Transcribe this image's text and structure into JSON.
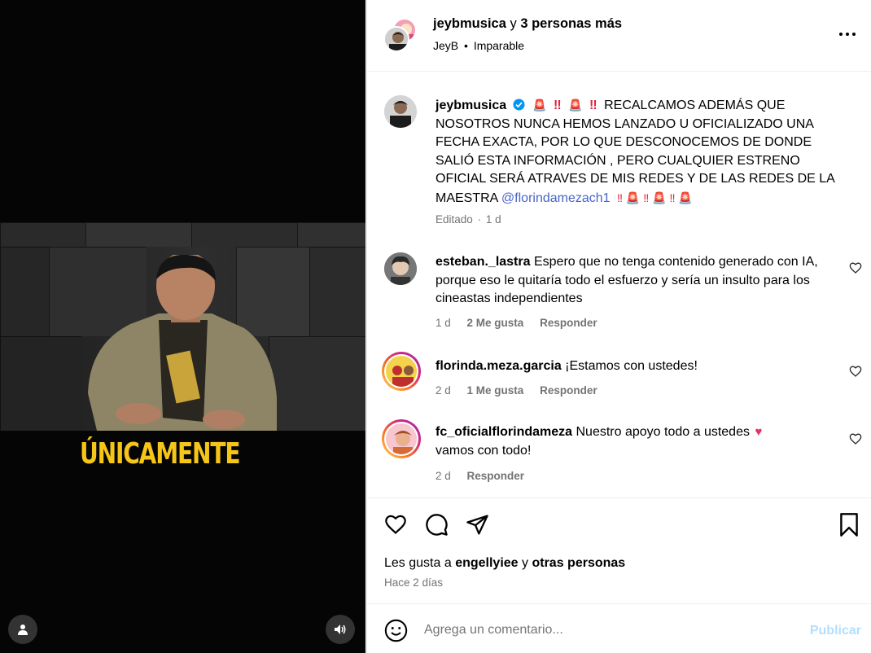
{
  "video": {
    "caption": "ÚNICAMENTE"
  },
  "header": {
    "username": "jeybmusica",
    "connector": "y",
    "others": "3 personas más",
    "audio_artist": "JeyB",
    "audio_separator": "•",
    "audio_title": "Imparable"
  },
  "caption_post": {
    "username": "jeybmusica",
    "text": "RECALCAMOS ADEMÁS QUE NOSOTROS NUNCA HEMOS LANZADO U OFICIALIZADO UNA FECHA EXACTA, POR LO QUE DESCONOCEMOS DE DONDE SALIÓ ESTA INFORMACIÓN , PERO CUALQUIER ESTRENO OFICIAL SERÁ ATRAVES DE MIS REDES Y DE LAS REDES DE LA MAESTRA",
    "mention": "@florindamezach1",
    "edited": "Editado",
    "dot": "·",
    "time": "1 d"
  },
  "comments": [
    {
      "username": "esteban._lastra",
      "text": "Espero que no tenga contenido generado con IA, porque eso le quitaría todo el esfuerzo y sería un insulto para los cineastas independientes",
      "time": "1 d",
      "likes": "2 Me gusta",
      "reply": "Responder"
    },
    {
      "username": "florinda.meza.garcia",
      "text": "¡Estamos con ustedes!",
      "time": "2 d",
      "likes": "1 Me gusta",
      "reply": "Responder"
    },
    {
      "username": "fc_oficialflorindameza",
      "text": "Nuestro apoyo todo a ustedes",
      "text2": "vamos con todo!",
      "time": "2 d",
      "reply": "Responder"
    }
  ],
  "likes": {
    "prefix": "Les gusta a",
    "user": "engellyiee",
    "connector": "y",
    "others": "otras personas",
    "when": "Hace 2 días"
  },
  "composer": {
    "placeholder": "Agrega un comentario...",
    "publish": "Publicar"
  },
  "colors": {
    "verified": "#0095f6",
    "publish_disabled": "#b2dffc",
    "caption_yellow": "#f5c518",
    "heart_emoji": "#e8315f"
  }
}
